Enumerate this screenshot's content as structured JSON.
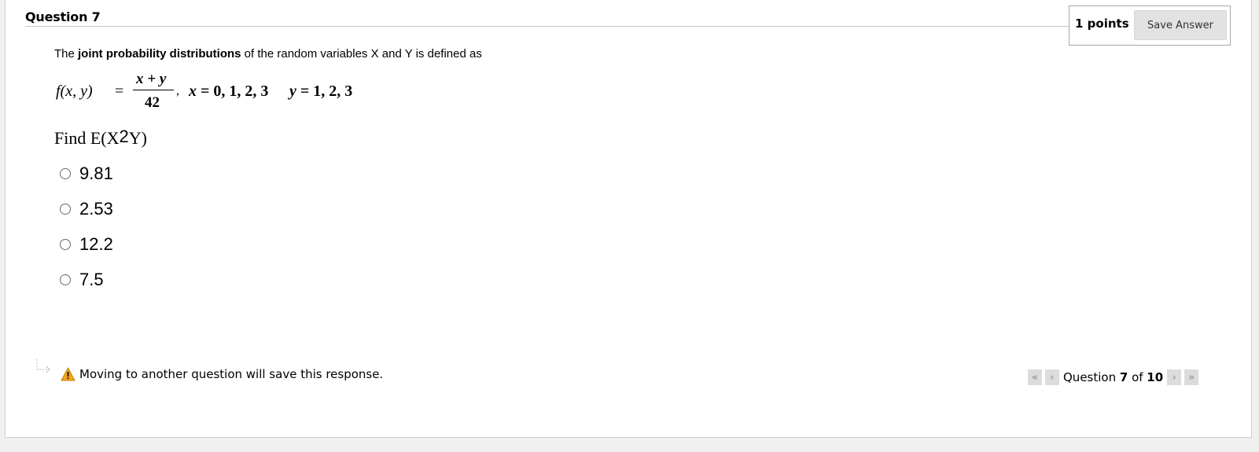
{
  "question": {
    "title": "Question 7",
    "points": "1 points",
    "save_label": "Save Answer",
    "prompt_pre": "The ",
    "prompt_bold": "joint probability distributions",
    "prompt_post": " of the random variables X and Y is defined as",
    "formula": {
      "lhs": "f(x, y)",
      "equals": "=",
      "numerator": "x + y",
      "denominator": "42",
      "x_var": "x",
      "x_values": " = 0, 1, 2, 3",
      "y_var": "y",
      "y_values": " = 1, 2, 3"
    },
    "find_pre": "Find E(X",
    "find_sup": "2",
    "find_post": "Y)",
    "options": [
      "9.81",
      "2.53",
      "12.2",
      "7.5"
    ]
  },
  "footer": {
    "warning": "Moving to another question will save this response.",
    "nav_prefix": "Question ",
    "nav_current": "7",
    "nav_of": " of ",
    "nav_total": "10"
  },
  "icons": {
    "warning": "warning-triangle-icon",
    "first": "double-chevron-left-icon",
    "prev": "chevron-left-icon",
    "next": "chevron-right-icon",
    "last": "double-chevron-right-icon"
  },
  "colors": {
    "save_button_bg": "#e2e2e2",
    "warning_icon": "#f5a623",
    "nav_button_bg": "#dcdcdc"
  }
}
